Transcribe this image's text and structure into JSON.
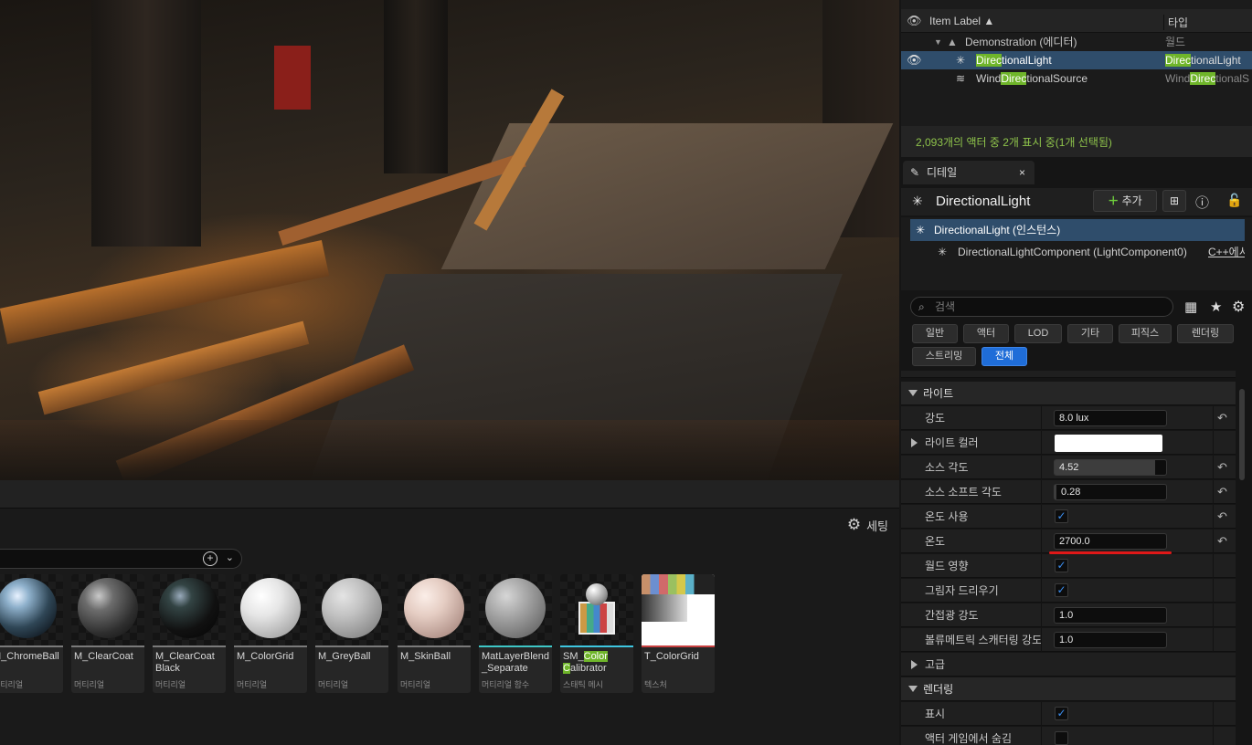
{
  "viewport": {
    "description_colors": {
      "warm": "#c8782a",
      "dark": "#1a1612"
    }
  },
  "content_browser": {
    "settings_label": "세팅",
    "assets": [
      {
        "name": "M_ChromeBall",
        "type": "머티리얼",
        "bar_color": "#7a7a7a",
        "sphere": "chrome"
      },
      {
        "name": "M_ClearCoat",
        "type": "머티리얼",
        "bar_color": "#7a7a7a",
        "sphere": "clearcoat"
      },
      {
        "name": "M_ClearCoat Black",
        "type": "머티리얼",
        "bar_color": "#7a7a7a",
        "sphere": "black"
      },
      {
        "name": "M_ColorGrid",
        "type": "머티리얼",
        "bar_color": "#7a7a7a",
        "sphere": "white"
      },
      {
        "name": "M_GreyBall",
        "type": "머티리얼",
        "bar_color": "#7a7a7a",
        "sphere": "grey"
      },
      {
        "name": "M_SkinBall",
        "type": "머티리얼",
        "bar_color": "#7a7a7a",
        "sphere": "skin"
      },
      {
        "name": "MatLayerBlend _Separate",
        "type": "머티리얼 함수",
        "bar_color": "#3ec6c6",
        "sphere": "checker"
      },
      {
        "name_pre": "SM_",
        "name_hl1": "Color",
        "name_hl2": "C",
        "name_post": "alibrator",
        "type": "스태틱 메시",
        "bar_color": "#3ec6e0",
        "sphere": "calibrator"
      },
      {
        "name": "T_ColorGrid",
        "type": "텍스처",
        "bar_color": "#c84040",
        "sphere": "texture"
      }
    ]
  },
  "outliner": {
    "col_label": "Item Label",
    "col_type": "타입",
    "world_name": "Demonstration (에디터)",
    "world_type": "월드",
    "rows": [
      {
        "pre": "",
        "hl": "Direc",
        "post": "tionalLight",
        "type_pre": "",
        "type_hl": "Direc",
        "type_post": "tionalLight",
        "selected": true
      },
      {
        "pre": "Wind",
        "hl": "Direc",
        "post": "tionalSource",
        "type_pre": "Wind",
        "type_hl": "Direc",
        "type_post": "tionalS",
        "selected": false
      }
    ],
    "status": "2,093개의 액터 중 2개 표시 중(1개 선택됨)"
  },
  "details": {
    "tab_label": "디테일",
    "actor_name": "DirectionalLight",
    "add_label": "추가",
    "components": {
      "instance": "DirectionalLight (인스턴스)",
      "component": "DirectionalLightComponent (LightComponent0)",
      "component_suffix": "C++에서"
    },
    "search_placeholder": "검색",
    "filters": [
      "일반",
      "액터",
      "LOD",
      "기타",
      "피직스",
      "렌더링",
      "스트리밍",
      "전체"
    ],
    "active_filter": "전체",
    "sections": {
      "light": "라이트",
      "advanced": "고급",
      "rendering": "렌더링"
    },
    "props": {
      "intensity": {
        "label": "강도",
        "value": "8.0 lux"
      },
      "light_color": {
        "label": "라이트 컬러",
        "value": "#ffffff"
      },
      "source_angle": {
        "label": "소스 각도",
        "value": "4.52",
        "fill": 0.9
      },
      "source_soft_angle": {
        "label": "소스 소프트 각도",
        "value": "0.28",
        "fill": 0.02
      },
      "use_temperature": {
        "label": "온도 사용",
        "checked": true
      },
      "temperature": {
        "label": "온도",
        "value": "2700.0"
      },
      "affects_world": {
        "label": "월드 영향",
        "checked": true
      },
      "cast_shadows": {
        "label": "그림자 드리우기",
        "checked": true
      },
      "indirect_intensity": {
        "label": "간접광 강도",
        "value": "1.0"
      },
      "volumetric_scattering": {
        "label": "볼류메트릭 스캐터링 강도",
        "value": "1.0"
      },
      "visible": {
        "label": "표시",
        "checked": true
      },
      "hidden_in_game": {
        "label": "액터 게임에서 숨김",
        "checked": false
      }
    }
  }
}
